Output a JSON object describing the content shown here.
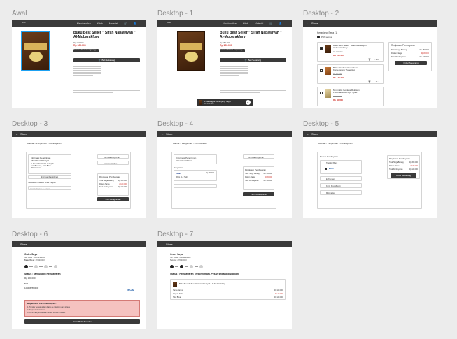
{
  "labels": [
    "Awal",
    "Desktop - 1",
    "Desktop - 2",
    "Desktop - 3",
    "Desktop - 4",
    "Desktop - 5",
    "Desktop - 6",
    "Desktop - 7"
  ],
  "nav": {
    "items": [
      "Merchandise",
      "Kitab",
      "Material"
    ]
  },
  "back": "Store",
  "product": {
    "title": "Buku Best Seller \" Sirah Nabawiyah \" Al-Mubarakfury",
    "sold": "Rp 135.000",
    "old_price": "Rp 150.000",
    "price": "Rp 120.000",
    "stock_btn": "Ketersediaan Langsung: Ya",
    "add_cart": "Beli Sekarang",
    "cover_top": "MUHAMMAD",
    "cover_sub": "SIRAH NABAWIYAH"
  },
  "toast": {
    "text": "1 Barang di Keranjang Saya",
    "sub": "Rp 120.000"
  },
  "cart": {
    "title": "Keranjang Saya (1)",
    "select_all": "Pilih semua",
    "items": [
      {
        "name": "Buku Best Seller \" Sirah Nabawiyah \" Al-Mubarakfury",
        "old": "Rp 150.000",
        "price": "Rp 120.000"
      },
      {
        "name": "Buku Panduan Pemodelan Kontemporer Parenting",
        "old": "Rp 90.000",
        "price": "Rp 149.000"
      },
      {
        "name": "Minimalist Gobless Rekitsun Pembuat Imam Aya Syafii",
        "old": "Rp 70.000",
        "price": "Rp 60.000"
      }
    ],
    "summary_title": "Ringkasan Pembayaran",
    "summary_rows": [
      "Total Harga Barang",
      "Diskon Harga",
      "Total Pembayaran"
    ],
    "summary_vals": [
      "Rp 150.000",
      "-Rp30.000",
      "Rp 120.000"
    ],
    "checkout": "Order Sekarang"
  },
  "breadcrumb": "Alamat > Pengiriman > Pembayaran",
  "address": {
    "title": "Informasi Pengiriman",
    "name": "Ahmad Fuad Hidayat",
    "lines": [
      "Jl. Mawar No.12, Kel. Sukajadi",
      "Kota Bandung, Jawa Barat",
      "0812xxxxxxxx"
    ],
    "edit": "Informasi Pengiriman",
    "note": "Tambahkan Catatan untuk Penjual",
    "note_ph": "Contoh: Titipkan ke satpam",
    "opt1": "Pilih Jasa Pengiriman",
    "opt2": "Gunakan Voucher",
    "cta": "Pilih Pengiriman"
  },
  "shipping": {
    "title": "Pengiriman",
    "courier": "JNE",
    "service": "REG (2-3 Hari)",
    "cost": "Rp 20.000",
    "total": "Rp 140.000",
    "cta": "Pilih Pembayaran"
  },
  "payment": {
    "title": "Metode Pembayaran",
    "options": [
      "Transfer Bank",
      "BCA",
      "E-Payment",
      "Kartu Kredit/Debit",
      "Minimarket"
    ],
    "cta": "Order Sekarang"
  },
  "order6": {
    "title": "Order Saya",
    "id": "No. Order : 000/123/2023",
    "date": "Batas Bayar: 27/02/2023",
    "status": "Status : Menunggu Pembayaran",
    "amount": "Rp 120.000",
    "va_label": "BCA",
    "va": "1234567890000",
    "note_title": "Bagaimana Cara Membayar ?",
    "steps": [
      "1. Transfer sesuai jumlah di atas ke rekening yang tertera",
      "2. Simpan bukti transfer",
      "3. Konfirmasi pembayaran melalui tombol di bawah"
    ],
    "cta": "Kirim Bukti Transfer"
  },
  "order7": {
    "title": "Order Saya",
    "id": "No. Order : 000/123/2023",
    "date": "Tanggal: 27/02/2023",
    "status": "Status : Pembayaran Terkonfirmasi, Pesan sedang disiapkan.",
    "item": "Buku Best Seller \" Sirah Nabawiyah \" Al-Mubarakfury",
    "rows": [
      "Harga Barang",
      "Ongkos Kirim",
      "Total Bayar"
    ],
    "vals": [
      "Rp 120.000",
      "Rp 20.000",
      "Rp 140.000"
    ]
  }
}
